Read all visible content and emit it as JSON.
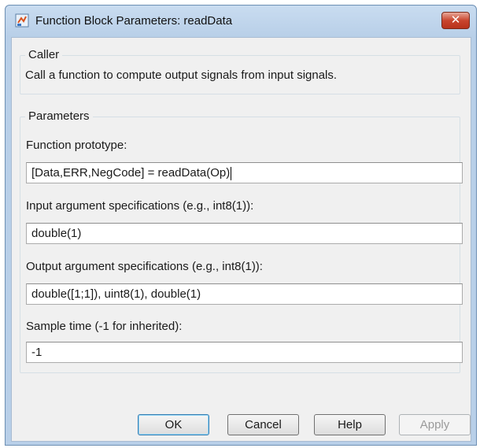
{
  "window": {
    "title": "Function Block Parameters: readData",
    "close_label": "✕"
  },
  "caller": {
    "legend": "Caller",
    "description": "Call a function to compute output signals from input signals."
  },
  "parameters": {
    "legend": "Parameters",
    "prototype_label": "Function prototype:",
    "prototype_value": "[Data,ERR,NegCode] = readData(Op)",
    "input_label": "Input argument specifications (e.g., int8(1)):",
    "input_value": "double(1)",
    "output_label": "Output argument specifications (e.g., int8(1)):",
    "output_value": "double([1;1]), uint8(1), double(1)",
    "sample_label": "Sample time (-1 for inherited):",
    "sample_value": "-1"
  },
  "buttons": {
    "ok": "OK",
    "cancel": "Cancel",
    "help": "Help",
    "apply": "Apply"
  },
  "colors": {
    "titlebar": "#b8cfe8",
    "close_button": "#c9452e",
    "client_background": "#f0f0f0"
  },
  "icons": {
    "window": "simulink-block-icon",
    "close": "close-icon"
  }
}
